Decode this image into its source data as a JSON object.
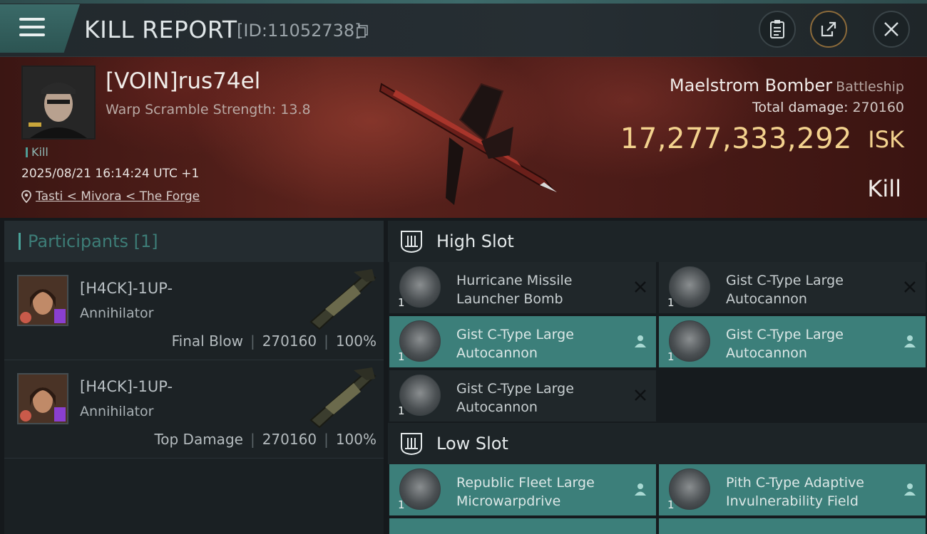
{
  "header": {
    "title": "KILL REPORT",
    "report_id": "[ID:11052738]",
    "icons": [
      "menu-icon",
      "copy-icon",
      "clipboard-icon",
      "share-icon",
      "close-icon"
    ]
  },
  "victim": {
    "name": "[VOIN]rus74el",
    "warp_scramble": "Warp Scramble Strength: 13.8",
    "kill_tag": "Kill",
    "datetime": "2025/08/21 16:14:24 UTC +1",
    "location": "Tasti < Mivora < The Forge",
    "ship_name": "Maelstrom Bomber",
    "ship_class": "Battleship",
    "total_damage_label": "Total damage:",
    "total_damage_value": "270160",
    "isk_value": "17,277,333,292",
    "isk_unit": "ISK",
    "result": "Kill"
  },
  "participants": {
    "header": "Participants",
    "count": "[1]",
    "rows": [
      {
        "name": "[H4CK]-1UP-",
        "ship": "Annihilator",
        "label": "Final Blow",
        "damage": "270160",
        "percent": "100%"
      },
      {
        "name": "[H4CK]-1UP-",
        "ship": "Annihilator",
        "label": "Top Damage",
        "damage": "270160",
        "percent": "100%"
      }
    ]
  },
  "slots": {
    "high": {
      "title": "High Slot",
      "modules": [
        {
          "name": "Hurricane Missile Launcher Bomb",
          "qty": "1",
          "state": "destroyed"
        },
        {
          "name": "Gist C-Type Large Autocannon",
          "qty": "1",
          "state": "destroyed"
        },
        {
          "name": "Gist C-Type Large Autocannon",
          "qty": "1",
          "state": "dropped"
        },
        {
          "name": "Gist C-Type Large Autocannon",
          "qty": "1",
          "state": "dropped"
        },
        {
          "name": "Gist C-Type Large Autocannon",
          "qty": "1",
          "state": "destroyed"
        }
      ]
    },
    "low": {
      "title": "Low Slot",
      "modules": [
        {
          "name": "Republic Fleet Large Microwarpdrive",
          "qty": "1",
          "state": "dropped"
        },
        {
          "name": "Pith C-Type Adaptive Invulnerability Field",
          "qty": "1",
          "state": "dropped"
        }
      ]
    }
  }
}
